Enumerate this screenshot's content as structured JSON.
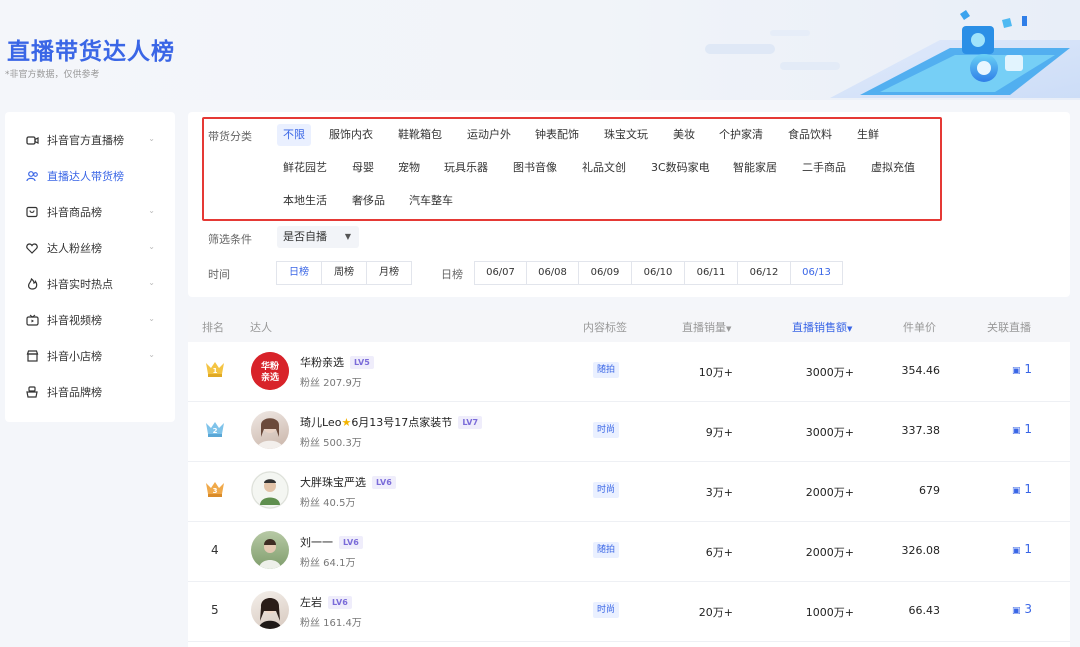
{
  "header": {
    "title": "直播带货达人榜",
    "subtitle": "*非官方数据，仅供参考"
  },
  "sidebar": {
    "items": [
      {
        "label": "抖音官方直播榜",
        "icon": "live-camera-icon",
        "expandable": true,
        "active": false
      },
      {
        "label": "直播达人带货榜",
        "icon": "people-icon",
        "expandable": false,
        "active": true
      },
      {
        "label": "抖音商品榜",
        "icon": "goods-box-icon",
        "expandable": true,
        "active": false
      },
      {
        "label": "达人粉丝榜",
        "icon": "heart-icon",
        "expandable": true,
        "active": false
      },
      {
        "label": "抖音实时热点",
        "icon": "fire-icon",
        "expandable": true,
        "active": false
      },
      {
        "label": "抖音视频榜",
        "icon": "video-tv-icon",
        "expandable": true,
        "active": false
      },
      {
        "label": "抖音小店榜",
        "icon": "shop-icon",
        "expandable": true,
        "active": false
      },
      {
        "label": "抖音品牌榜",
        "icon": "brand-icon",
        "expandable": false,
        "active": false
      }
    ]
  },
  "filter": {
    "category_label": "带货分类",
    "categories": [
      "不限",
      "服饰内衣",
      "鞋靴箱包",
      "运动户外",
      "钟表配饰",
      "珠宝文玩",
      "美妆",
      "个护家清",
      "食品饮料",
      "生鲜",
      "鲜花园艺",
      "母婴",
      "宠物",
      "玩具乐器",
      "图书音像",
      "礼品文创",
      "3C数码家电",
      "智能家居",
      "二手商品",
      "虚拟充值",
      "本地生活",
      "奢侈品",
      "汽车整车"
    ],
    "active_category": "不限",
    "condition_label": "筛选条件",
    "condition_value": "是否自播",
    "time_label": "时间",
    "periods": [
      "日榜",
      "周榜",
      "月榜"
    ],
    "active_period": "日榜",
    "day_label": "日榜",
    "dates": [
      "06/07",
      "06/08",
      "06/09",
      "06/10",
      "06/11",
      "06/12",
      "06/13"
    ],
    "active_date": "06/13"
  },
  "table": {
    "headers": {
      "rank": "排名",
      "influencer": "达人",
      "content_tag": "内容标签",
      "live_sales": "直播销量",
      "live_revenue": "直播销售额",
      "unit_price": "件单价",
      "related_live": "关联直播"
    },
    "sort_icon": "caret-down-icon",
    "rows": [
      {
        "rank": "1",
        "medal": "gold",
        "name": "华粉亲选",
        "level": "LV5",
        "fans": "粉丝 207.9万",
        "tag": "随拍",
        "sales": "10万+",
        "revenue": "3000万+",
        "unit_price": "354.46",
        "live_count": "1",
        "avatar_text": "华粉\n亲选"
      },
      {
        "rank": "2",
        "medal": "silver",
        "name": "琦儿Leo",
        "name_suffix": "6月13号17点家装节",
        "level": "LV7",
        "fans": "粉丝 500.3万",
        "tag": "时尚",
        "sales": "9万+",
        "revenue": "3000万+",
        "unit_price": "337.38",
        "live_count": "1"
      },
      {
        "rank": "3",
        "medal": "bronze",
        "name": "大胖珠宝严选",
        "level": "LV6",
        "fans": "粉丝 40.5万",
        "tag": "时尚",
        "sales": "3万+",
        "revenue": "2000万+",
        "unit_price": "679",
        "live_count": "1"
      },
      {
        "rank": "4",
        "name": "刘一一",
        "level": "LV6",
        "fans": "粉丝 64.1万",
        "tag": "随拍",
        "sales": "6万+",
        "revenue": "2000万+",
        "unit_price": "326.08",
        "live_count": "1"
      },
      {
        "rank": "5",
        "name": "左岩",
        "level": "LV6",
        "fans": "粉丝 161.4万",
        "tag": "时尚",
        "sales": "20万+",
        "revenue": "1000万+",
        "unit_price": "66.43",
        "live_count": "3"
      }
    ]
  },
  "colors": {
    "accent": "#3a66e6",
    "highlight_frame": "#e53935",
    "level_badge": "#7b6cd9"
  }
}
